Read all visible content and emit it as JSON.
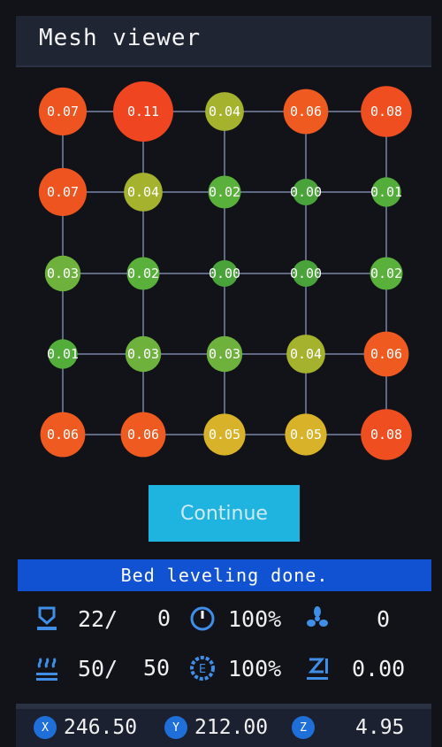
{
  "title": "Mesh viewer",
  "mesh": {
    "rows": [
      [
        "0.07",
        "0.11",
        "0.04",
        "0.06",
        "0.08"
      ],
      [
        "0.07",
        "0.04",
        "0.02",
        "0.00",
        "0.01"
      ],
      [
        "0.03",
        "0.02",
        "0.00",
        "0.00",
        "0.02"
      ],
      [
        "0.01",
        "0.03",
        "0.03",
        "0.04",
        "0.06"
      ],
      [
        "0.06",
        "0.06",
        "0.05",
        "0.05",
        "0.08"
      ]
    ],
    "colors": {
      "0.00": "#4aa33a",
      "0.01": "#53ad3a",
      "0.02": "#59b03a",
      "0.03": "#6eb13c",
      "0.04": "#a5b22e",
      "0.05": "#d8b228",
      "0.06": "#ee5a1f",
      "0.07": "#ee5420",
      "0.08": "#ef4f20",
      "0.11": "#ef4520"
    }
  },
  "continue_label": "Continue",
  "status": "Bed leveling done.",
  "stats": {
    "bed_temp": "22/",
    "bed_target": "0",
    "speed": "100%",
    "fan": "0",
    "nozzle_temp": "50/",
    "nozzle_target": "50",
    "flow": "100%",
    "z_offset": "0.00"
  },
  "axes": {
    "x_label": "X",
    "x": "246.50",
    "y_label": "Y",
    "y": "212.00",
    "z_label": "Z",
    "z": "4.95"
  },
  "icons": [
    "bed-icon",
    "speed-gauge-icon",
    "fan-icon",
    "heater-icon",
    "flow-e-icon",
    "z-offset-icon",
    "x-axis-icon",
    "y-axis-icon",
    "z-axis-icon"
  ]
}
